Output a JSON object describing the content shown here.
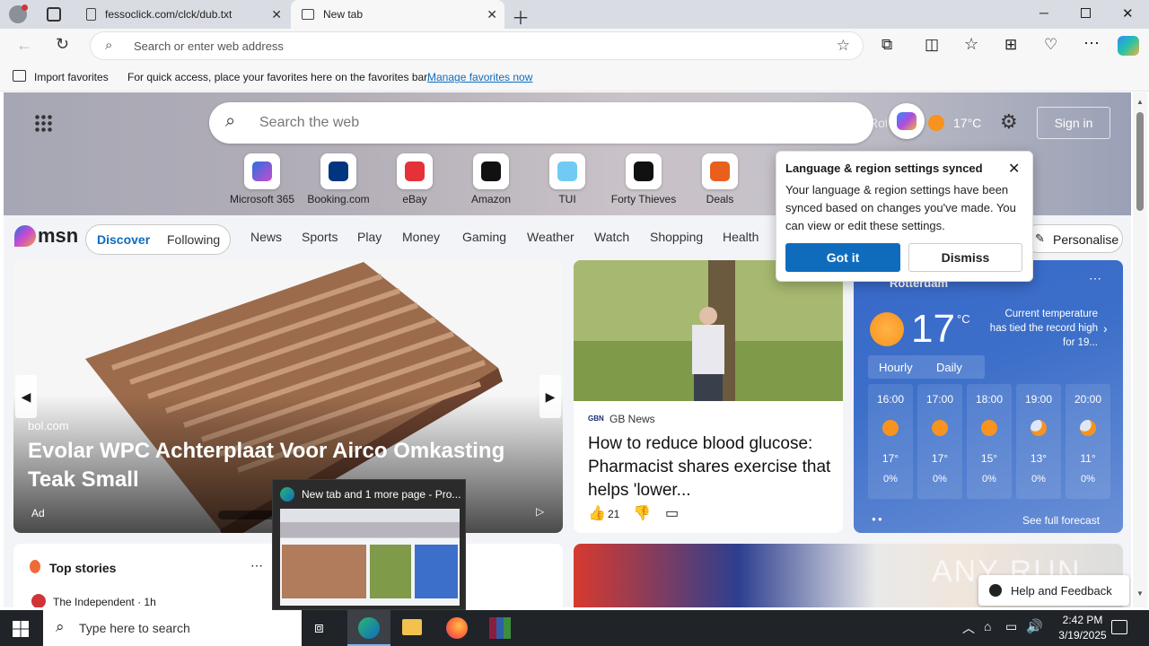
{
  "browser": {
    "tabs": [
      {
        "label": "fessoclick.com/clck/dub.txt"
      },
      {
        "label": "New tab"
      }
    ],
    "address_placeholder": "Search or enter web address",
    "favorites_bar": {
      "import_label": "Import favorites",
      "hint": "For quick access, place your favorites here on the favorites bar.",
      "manage_link": "Manage favorites now"
    }
  },
  "newtab": {
    "search_placeholder": "Search the web",
    "overlay_text": "Rotterdam",
    "weather_small": "17°C",
    "sign_in": "Sign in",
    "quick_links": [
      {
        "label": "Microsoft 365",
        "icon": "microsoft365-icon"
      },
      {
        "label": "Booking.com",
        "icon": "booking-icon"
      },
      {
        "label": "eBay",
        "icon": "ebay-icon"
      },
      {
        "label": "Amazon",
        "icon": "amazon-icon"
      },
      {
        "label": "TUI",
        "icon": "tui-icon"
      },
      {
        "label": "Forty Thieves",
        "icon": "forty-thieves-icon"
      },
      {
        "label": "Deals",
        "icon": "deals-icon"
      }
    ],
    "msn_logo": "msn",
    "segments": [
      "Discover",
      "Following"
    ],
    "nav": [
      "News",
      "Sports",
      "Play",
      "Money",
      "Gaming",
      "Weather",
      "Watch",
      "Shopping",
      "Health"
    ],
    "personalise": "Personalise"
  },
  "popup": {
    "title": "Language & region settings synced",
    "body": "Your language & region settings have been synced based on changes you've made. You can view or edit these settings.",
    "primary": "Got it",
    "secondary": "Dismiss"
  },
  "hero_card": {
    "source": "bol.com",
    "title": "Evolar WPC Achterplaat Voor Airco Omkasting Teak Small",
    "ad": "Ad"
  },
  "news_card": {
    "source": "GB News",
    "source_badge": "GBN",
    "title": "How to reduce blood glucose: Pharmacist shares exercise that helps 'lower...",
    "likes": "21"
  },
  "weather": {
    "city": "Rotterdam",
    "temp": "17",
    "unit": "°C",
    "note": "Current temperature has tied the record high for 19...",
    "tabs": [
      "Hourly",
      "Daily"
    ],
    "hours": [
      {
        "time": "16:00",
        "temp": "17°",
        "rain": "0%"
      },
      {
        "time": "17:00",
        "temp": "17°",
        "rain": "0%"
      },
      {
        "time": "18:00",
        "temp": "15°",
        "rain": "0%"
      },
      {
        "time": "19:00",
        "temp": "13°",
        "rain": "0%"
      },
      {
        "time": "20:00",
        "temp": "11°",
        "rain": "0%"
      }
    ],
    "forecast_link": "See full forecast"
  },
  "top_stories": {
    "title": "Top stories",
    "first_source": "The Independent · 1h"
  },
  "thumbnail": {
    "title": "New tab and 1 more page - Pro..."
  },
  "help": "Help and Feedback",
  "watermark": "ANY RUN",
  "taskbar": {
    "search_placeholder": "Type here to search",
    "time": "2:42 PM",
    "date": "3/19/2025"
  },
  "colors": {
    "accent": "#0f6cbd",
    "taskbar": "#202428",
    "weather_bg": "#3c6fc9"
  }
}
